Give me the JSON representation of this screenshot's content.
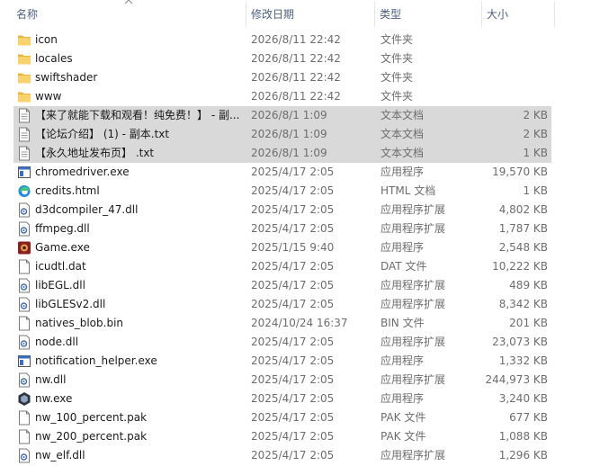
{
  "columns": {
    "name": "名称",
    "date": "修改日期",
    "type": "类型",
    "size": "大小"
  },
  "files": [
    {
      "name": "icon",
      "date": "2026/8/11 22:42",
      "type": "文件夹",
      "size": "",
      "icon": "folder-icon"
    },
    {
      "name": "locales",
      "date": "2026/8/11 22:42",
      "type": "文件夹",
      "size": "",
      "icon": "folder-icon"
    },
    {
      "name": "swiftshader",
      "date": "2026/8/11 22:42",
      "type": "文件夹",
      "size": "",
      "icon": "folder-icon"
    },
    {
      "name": "www",
      "date": "2026/8/11 22:42",
      "type": "文件夹",
      "size": "",
      "icon": "folder-icon"
    },
    {
      "name": "【来了就能下载和观看！纯免费！】 - 副...",
      "date": "2026/8/1 1:09",
      "type": "文本文档",
      "size": "2 KB",
      "icon": "text-file-icon",
      "selected": true
    },
    {
      "name": "【论坛介绍】 (1) - 副本.txt",
      "date": "2026/8/1 1:09",
      "type": "文本文档",
      "size": "2 KB",
      "icon": "text-file-icon",
      "selected": true
    },
    {
      "name": "【永久地址发布页】 .txt",
      "date": "2026/8/1 1:09",
      "type": "文本文档",
      "size": "1 KB",
      "icon": "text-file-icon",
      "selected": true
    },
    {
      "name": "chromedriver.exe",
      "date": "2025/4/17 2:05",
      "type": "应用程序",
      "size": "19,570 KB",
      "icon": "exe-window-icon"
    },
    {
      "name": "credits.html",
      "date": "2025/4/17 2:05",
      "type": "HTML 文档",
      "size": "1 KB",
      "icon": "edge-html-icon"
    },
    {
      "name": "d3dcompiler_47.dll",
      "date": "2025/4/17 2:05",
      "type": "应用程序扩展",
      "size": "4,802 KB",
      "icon": "dll-gear-icon"
    },
    {
      "name": "ffmpeg.dll",
      "date": "2025/4/17 2:05",
      "type": "应用程序扩展",
      "size": "1,787 KB",
      "icon": "dll-gear-icon"
    },
    {
      "name": "Game.exe",
      "date": "2025/1/15 9:40",
      "type": "应用程序",
      "size": "2,548 KB",
      "icon": "game-app-icon"
    },
    {
      "name": "icudtl.dat",
      "date": "2025/4/17 2:05",
      "type": "DAT 文件",
      "size": "10,222 KB",
      "icon": "blank-file-icon"
    },
    {
      "name": "libEGL.dll",
      "date": "2025/4/17 2:05",
      "type": "应用程序扩展",
      "size": "489 KB",
      "icon": "dll-gear-icon"
    },
    {
      "name": "libGLESv2.dll",
      "date": "2025/4/17 2:05",
      "type": "应用程序扩展",
      "size": "8,342 KB",
      "icon": "dll-gear-icon"
    },
    {
      "name": "natives_blob.bin",
      "date": "2024/10/24 16:37",
      "type": "BIN 文件",
      "size": "201 KB",
      "icon": "blank-file-icon"
    },
    {
      "name": "node.dll",
      "date": "2025/4/17 2:05",
      "type": "应用程序扩展",
      "size": "23,073 KB",
      "icon": "dll-gear-icon"
    },
    {
      "name": "notification_helper.exe",
      "date": "2025/4/17 2:05",
      "type": "应用程序",
      "size": "1,332 KB",
      "icon": "exe-window-icon"
    },
    {
      "name": "nw.dll",
      "date": "2025/4/17 2:05",
      "type": "应用程序扩展",
      "size": "244,973 KB",
      "icon": "dll-gear-icon"
    },
    {
      "name": "nw.exe",
      "date": "2025/4/17 2:05",
      "type": "应用程序",
      "size": "3,240 KB",
      "icon": "nwjs-app-icon"
    },
    {
      "name": "nw_100_percent.pak",
      "date": "2025/4/17 2:05",
      "type": "PAK 文件",
      "size": "677 KB",
      "icon": "blank-file-icon"
    },
    {
      "name": "nw_200_percent.pak",
      "date": "2025/4/17 2:05",
      "type": "PAK 文件",
      "size": "1,088 KB",
      "icon": "blank-file-icon"
    },
    {
      "name": "nw_elf.dll",
      "date": "2025/4/17 2:05",
      "type": "应用程序扩展",
      "size": "1,296 KB",
      "icon": "dll-gear-icon"
    }
  ]
}
